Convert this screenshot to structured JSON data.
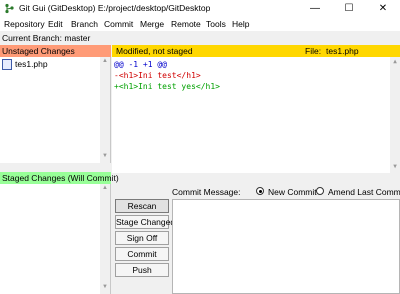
{
  "window": {
    "title": "Git Gui (GitDesktop) E:/project/desktop/GitDesktop",
    "minimize_glyph": "—",
    "maximize_glyph": "☐",
    "close_glyph": "✕"
  },
  "menu": [
    "Repository",
    "Edit",
    "Branch",
    "Commit",
    "Merge",
    "Remote",
    "Tools",
    "Help"
  ],
  "branch_line": "Current Branch: master",
  "unstaged": {
    "header": "Unstaged Changes",
    "header_color": "#ff9b77",
    "files": [
      "tes1.php"
    ]
  },
  "staged": {
    "header": "Staged Changes (Will Commit)",
    "header_color": "#98ff98"
  },
  "diff": {
    "status": "Modified, not staged",
    "file_label": "File:",
    "file_name": "tes1.php",
    "header_color": "#ffd700",
    "lines": [
      "@@ -1 +1 @@",
      "-<h1>Ini test</h1>",
      "+<h1>Ini test yes</h1>"
    ]
  },
  "commit": {
    "message_label": "Commit Message:",
    "new_commit_label": "New Commit",
    "amend_label": "Amend Last Commit",
    "buttons": {
      "rescan": "Rescan",
      "stage_changed": "Stage Changed",
      "sign_off": "Sign Off",
      "commit": "Commit",
      "push": "Push"
    }
  }
}
